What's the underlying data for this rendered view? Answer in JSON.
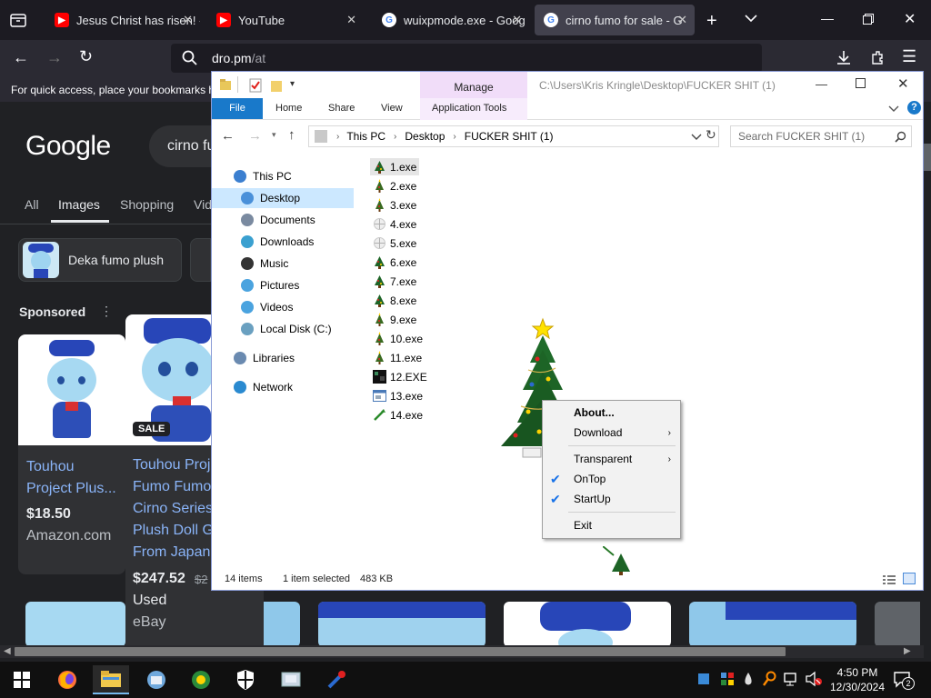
{
  "browser": {
    "tabs": [
      {
        "label": "Jesus Christ has risen! -",
        "type": "youtube"
      },
      {
        "label": "YouTube",
        "type": "youtube"
      },
      {
        "label": "wuixpmode.exe - Goog",
        "type": "google"
      },
      {
        "label": "cirno fumo for sale - G",
        "type": "google",
        "active": true
      }
    ],
    "url": "dro.pm/at",
    "url_domain": "dro.pm",
    "url_path": "/at",
    "bookmarks_text": "For quick access, place your bookmarks h"
  },
  "google": {
    "logo": "Google",
    "search_value": "cirno fu",
    "tabs": [
      "All",
      "Images",
      "Shopping",
      "Vid"
    ],
    "active_tab": "Images",
    "chip_label": "Deka fumo plush",
    "sponsored": "Sponsored",
    "products": [
      {
        "title_lines": [
          "Touhou",
          "Project Plus..."
        ],
        "price": "$18.50",
        "seller": "Amazon.com"
      },
      {
        "badge": "SALE",
        "title_lines": [
          "Touhou Proj",
          "Fumo Fumo",
          "Cirno Series",
          "Plush Doll G",
          "From Japan"
        ],
        "price": "$247.52",
        "old_price": "$2",
        "condition": "Used",
        "seller": "eBay"
      }
    ]
  },
  "explorer": {
    "title_path": "C:\\Users\\Kris Kringle\\Desktop\\FUCKER SHIT (1)",
    "manage_label": "Manage",
    "ribbon_tabs": [
      "File",
      "Home",
      "Share",
      "View",
      "Application Tools"
    ],
    "breadcrumb": [
      "This PC",
      "Desktop",
      "FUCKER SHIT (1)"
    ],
    "search_placeholder": "Search FUCKER SHIT (1)",
    "nav": [
      {
        "label": "This PC",
        "level": 0,
        "color": "#3b7fd0"
      },
      {
        "label": "Desktop",
        "level": 1,
        "selected": true,
        "color": "#4a90d9"
      },
      {
        "label": "Documents",
        "level": 1,
        "color": "#7a8aa0"
      },
      {
        "label": "Downloads",
        "level": 1,
        "color": "#3aa0d0"
      },
      {
        "label": "Music",
        "level": 1,
        "color": "#333333"
      },
      {
        "label": "Pictures",
        "level": 1,
        "color": "#4aa3df"
      },
      {
        "label": "Videos",
        "level": 1,
        "color": "#4aa3df"
      },
      {
        "label": "Local Disk (C:)",
        "level": 1,
        "color": "#6aa0c0"
      },
      {
        "label": "Libraries",
        "level": 0,
        "color": "#6a8ab0"
      },
      {
        "label": "Network",
        "level": 0,
        "color": "#2a8ad0"
      }
    ],
    "files": [
      {
        "name": "1.exe",
        "icon": "tree-icon",
        "selected": true
      },
      {
        "name": "2.exe",
        "icon": "small-tree-icon"
      },
      {
        "name": "3.exe",
        "icon": "small-tree-icon"
      },
      {
        "name": "4.exe",
        "icon": "snowflake-icon"
      },
      {
        "name": "5.exe",
        "icon": "snowflake-icon"
      },
      {
        "name": "6.exe",
        "icon": "tree-icon"
      },
      {
        "name": "7.exe",
        "icon": "tree-icon"
      },
      {
        "name": "8.exe",
        "icon": "tree-icon"
      },
      {
        "name": "9.exe",
        "icon": "small-tree-icon"
      },
      {
        "name": "10.exe",
        "icon": "small-tree-icon"
      },
      {
        "name": "11.exe",
        "icon": "small-tree-icon"
      },
      {
        "name": "12.EXE",
        "icon": "dark-app-icon"
      },
      {
        "name": "13.exe",
        "icon": "window-app-icon"
      },
      {
        "name": "14.exe",
        "icon": "green-arrow-icon"
      }
    ],
    "status_items": "14 items",
    "status_selected": "1 item selected",
    "status_size": "483 KB"
  },
  "context_menu": {
    "items": [
      {
        "label": "About...",
        "bold": true
      },
      {
        "label": "Download",
        "submenu": true
      },
      {
        "label": "Transparent",
        "submenu": true
      },
      {
        "label": "OnTop",
        "checked": true
      },
      {
        "label": "StartUp",
        "checked": true
      },
      {
        "label": "Exit"
      }
    ]
  },
  "taskbar": {
    "time": "4:50 PM",
    "date": "12/30/2024",
    "notification_count": "2"
  }
}
